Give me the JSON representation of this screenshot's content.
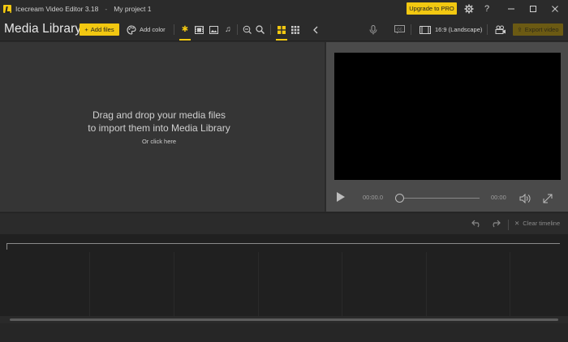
{
  "titlebar": {
    "app_name": "Icecream Video Editor 3.18",
    "separator": "-",
    "project_name": "My project 1",
    "upgrade_label": "Upgrade to PRO",
    "icons": [
      "settings-icon",
      "help-icon",
      "minimize-icon",
      "maximize-icon",
      "close-icon"
    ]
  },
  "toolbar": {
    "library_title": "Media Library",
    "add_files_label": "Add files",
    "add_color_label": "Add color",
    "filters": [
      "all",
      "video",
      "image",
      "audio"
    ],
    "aspect_label": "16:9 (Landscape)",
    "export_label": "Export video"
  },
  "library": {
    "drop_line1": "Drag and drop your media files",
    "drop_line2": "to import them into Media Library",
    "click_here": "Or click here"
  },
  "player": {
    "current_time": "00:00.0",
    "total_time": "00:00"
  },
  "timeline": {
    "clear_label": "Clear timeline"
  },
  "colors": {
    "accent": "#f2c811",
    "background": "#2b2b2b",
    "library_bg": "#353535",
    "preview_bg": "#4a4a4a",
    "timeline_bg": "#202020"
  }
}
